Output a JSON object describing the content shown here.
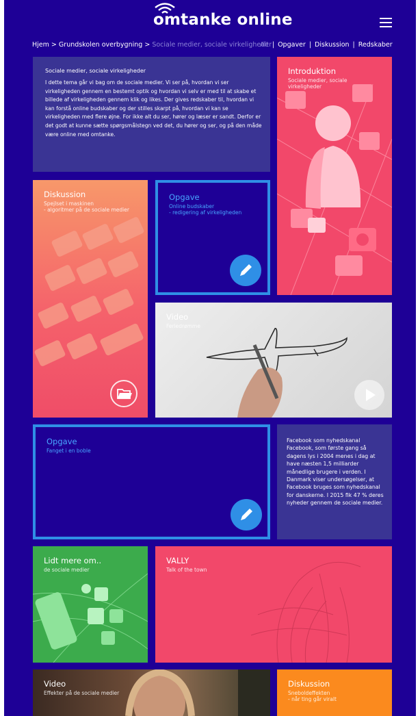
{
  "header": {
    "brand": "omtanke online"
  },
  "breadcrumb": {
    "home": "Hjem",
    "sep": ">",
    "level1": "Grundskolen overbygning",
    "current": "Sociale medier, sociale virkeligheder"
  },
  "filters": [
    "Alt",
    "Opgaver",
    "Diskussion",
    "Redskaber"
  ],
  "intro": {
    "heading": "Sociale medier, sociale virkeligheder",
    "body": "I dette tema går vi bag om de sociale medier. Vi ser på, hvordan vi ser virkeligheden gennem en bestemt optik og hvordan vi selv er med til at skabe et billede af virkeligheden gennem klik og likes. Der gives redskaber til, hvordan vi kan forstå online budskaber og der stilles skarpt på, hvordan vi kan se virkeligheden med flere øjne. For ikke alt du ser, hører og læser er sandt. Derfor er det godt at kunne sætte spørgsmålstegn ved det, du hører og ser, og på den måde være online med omtanke."
  },
  "tiles": {
    "introduktion": {
      "title": "Introduktion",
      "sub": "Sociale medier, sociale virkeligheder"
    },
    "diskussion1": {
      "title": "Diskussion",
      "sub1": "Spejlset i maskinen",
      "sub2": "- algoritmer på de sociale medier"
    },
    "opgave1": {
      "title": "Opgave",
      "sub1": "Online budskaber",
      "sub2": "- redigering af virkeligheden"
    },
    "video1": {
      "title": "Video",
      "sub": "Feriedrømme"
    },
    "opgave2": {
      "title": "Opgave",
      "sub": "Fanget i en boble"
    },
    "facebook": {
      "text": "Facebook som nyhedskanal Facebook, som første gang så dagens lys i 2004 menes i dag at have næsten 1,5 milliarder månedlige brugere i verden. I Danmark viser undersøgelser, at Facebook bruges som nyhedskanal for danskerne. I 2015 fik 47 % deres nyheder gennem de sociale medier."
    },
    "lidtmere": {
      "title": "Lidt mere om..",
      "sub": "de sociale medier"
    },
    "vally": {
      "title": "VALLY",
      "sub": "Talk of the town"
    },
    "video2": {
      "title": "Video",
      "sub": "Effekter på de sociale medier"
    },
    "diskussion2": {
      "title": "Diskussion",
      "sub1": "Sneboldeffekten",
      "sub2": "- når ting går viralt"
    }
  },
  "colors": {
    "page_bg": "#1e0096",
    "panel": "#3a3494",
    "pink": "#f2486a",
    "accent_blue": "#2f8fe6",
    "green": "#3cab4c",
    "orange": "#fb8a1e"
  }
}
